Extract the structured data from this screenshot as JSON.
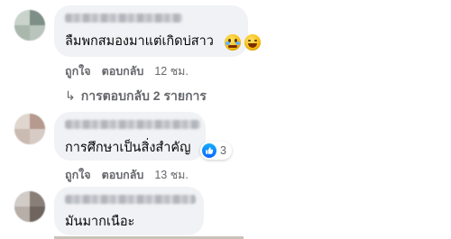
{
  "comments": [
    {
      "text": "ลืมพกสมองมาแต่เกิดบ่สาว",
      "emojis": [
        "face-holding-back-tears-icon",
        "laughing-face-icon"
      ],
      "actions": [
        "ถูกใจ",
        "ตอบกลับ"
      ],
      "time": "12 ชม.",
      "replies": "การตอบกลับ 2 รายการ"
    },
    {
      "text": "การศึกษาเป็นสิ่งสำคัญ",
      "reaction": {
        "icon": "like-icon",
        "count": "3"
      },
      "actions": [
        "ถูกใจ",
        "ตอบกลับ"
      ],
      "time": "13 ชม."
    },
    {
      "text": "มันมากเนือะ"
    }
  ],
  "colors": {
    "bubble": "#f0f2f5",
    "meta_text": "#65676b",
    "like_blue": "#0866ff"
  }
}
